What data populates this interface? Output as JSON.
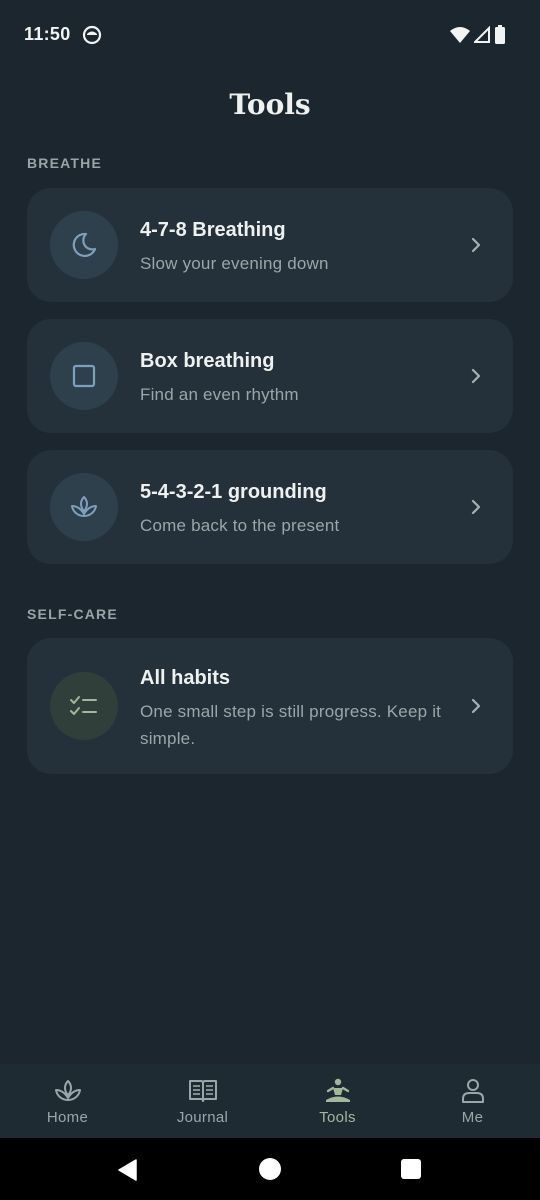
{
  "status": {
    "time": "11:50"
  },
  "header": {
    "title": "Tools"
  },
  "sections": [
    {
      "label": "BREATHE",
      "items": [
        {
          "title": "4-7-8 Breathing",
          "subtitle": "Slow your evening down",
          "icon": "moon-icon"
        },
        {
          "title": "Box breathing",
          "subtitle": "Find an even rhythm",
          "icon": "square-icon"
        },
        {
          "title": "5-4-3-2-1 grounding",
          "subtitle": "Come back to the present",
          "icon": "lotus-icon"
        }
      ]
    },
    {
      "label": "SELF-CARE",
      "items": [
        {
          "title": "All habits",
          "subtitle": "One small step is still progress. Keep it simple.",
          "icon": "checklist-icon"
        }
      ]
    }
  ],
  "bottom_nav": {
    "items": [
      {
        "label": "Home",
        "icon": "lotus-icon"
      },
      {
        "label": "Journal",
        "icon": "book-icon"
      },
      {
        "label": "Tools",
        "icon": "meditation-icon",
        "active": true
      },
      {
        "label": "Me",
        "icon": "person-icon"
      }
    ]
  },
  "colors": {
    "background": "#1b262e",
    "card": "#24313a",
    "accent_blue": "#7f9fbd",
    "accent_green": "#a3b89a"
  }
}
